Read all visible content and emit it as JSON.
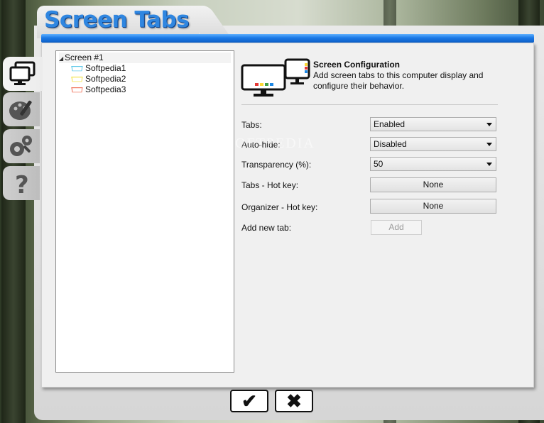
{
  "window": {
    "title": "Screen Tabs"
  },
  "side_tabs": [
    {
      "icon": "monitor-icon",
      "active": true
    },
    {
      "icon": "palette-icon",
      "active": false
    },
    {
      "icon": "gears-icon",
      "active": false
    },
    {
      "icon": "question-icon",
      "active": false
    }
  ],
  "tree": {
    "root_label": "Screen #1",
    "items": [
      {
        "label": "Softpedia1",
        "color": "#4fc3e6"
      },
      {
        "label": "Softpedia2",
        "color": "#f2e23a"
      },
      {
        "label": "Softpedia3",
        "color": "#f0694f"
      }
    ]
  },
  "config": {
    "title": "Screen Configuration",
    "description": "Add screen tabs to this computer display and configure their behavior."
  },
  "settings": {
    "tabs_label": "Tabs:",
    "tabs_value": "Enabled",
    "autohide_label": "Auto-hide:",
    "autohide_value": "Disabled",
    "transparency_label": "Transparency (%):",
    "transparency_value": "50",
    "tabs_hotkey_label": "Tabs - Hot key:",
    "tabs_hotkey_value": "None",
    "organizer_hotkey_label": "Organizer - Hot key:",
    "organizer_hotkey_value": "None",
    "add_tab_label": "Add new tab:",
    "add_button": "Add"
  },
  "watermark": "SOFTPEDIA",
  "dialog": {
    "ok_symbol": "✔",
    "cancel_symbol": "✖"
  },
  "colors": {
    "accent_blue": "#1a79e6",
    "title_blue": "#2f86e0"
  }
}
